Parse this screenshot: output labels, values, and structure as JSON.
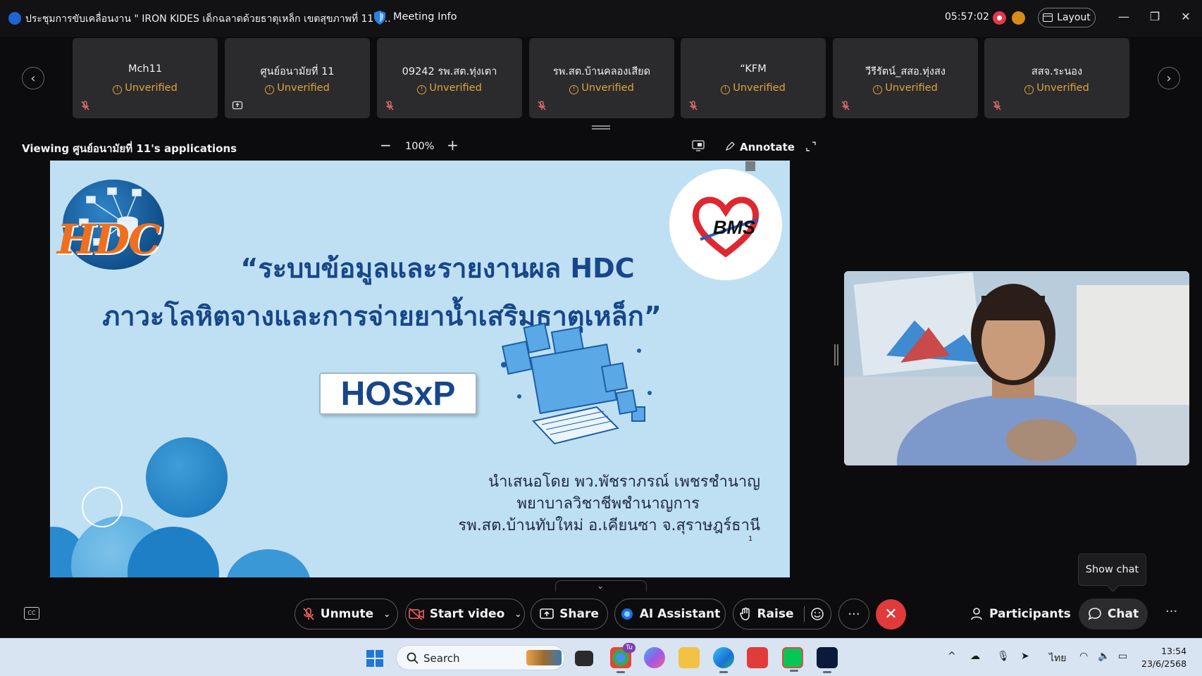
{
  "window": {
    "title": "ประชุมการขับเคลื่อนงาน \" IRON KIDES เด็กฉลาดด้วยธาตุเหล็ก เขตสุขภาพที่ 11\" ...",
    "meeting_info": "Meeting Info",
    "elapsed_time": "05:57:02",
    "layout_label": "Layout"
  },
  "participants": [
    {
      "name": "Mch11",
      "status": "Unverified",
      "icon": "mic-muted-icon"
    },
    {
      "name": "ศูนย์อนามัยที่ 11",
      "status": "Unverified",
      "icon": "screen-share-icon"
    },
    {
      "name": "09242 รพ.สต.ทุ่งเตา",
      "status": "Unverified",
      "icon": "mic-muted-icon"
    },
    {
      "name": "รพ.สต.บ้านคลองเสียด",
      "status": "Unverified",
      "icon": "mic-muted-icon"
    },
    {
      "name": "“KFM",
      "status": "Unverified",
      "icon": "mic-muted-icon"
    },
    {
      "name": "วีรีรัตน์_สสอ.ทุ่งสง",
      "status": "Unverified",
      "icon": "mic-muted-icon"
    },
    {
      "name": "สสจ.ระนอง",
      "status": "Unverified",
      "icon": "mic-muted-icon"
    }
  ],
  "view_bar": {
    "viewing_label": "Viewing ศูนย์อนามัยที่ 11's applications",
    "zoom_minus": "−",
    "zoom_level": "100%",
    "zoom_plus": "+",
    "annotate_label": "Annotate"
  },
  "slide": {
    "hdc_logo_text": "HDC",
    "bms_logo_text": "BMS",
    "title_line1": "“ระบบข้อมูลและรายงานผล HDC",
    "title_line2": "ภาวะโลหิตจางและการจ่ายยาน้ำเสริมธาตุเหล็ก”",
    "hosxp_label": "HOSxP",
    "presenter_line1": "นำเสนอโดย  พว.พัชราภรณ์  เพชรชำนาญ",
    "presenter_line2": "พยาบาลวิชาชีพชำนาญการ",
    "presenter_line3": "รพ.สต.บ้านทับใหม่ อ.เคียนซา จ.สุราษฎร์ธานี",
    "page_number": "1"
  },
  "toolbar": {
    "unmute": "Unmute",
    "start_video": "Start video",
    "share": "Share",
    "ai_assistant": "AI Assistant",
    "raise": "Raise",
    "more": "···",
    "end": "✕",
    "participants": "Participants",
    "chat": "Chat",
    "overflow": "···",
    "tooltip": "Show chat"
  },
  "taskbar": {
    "search_placeholder": "Search",
    "chrome_badge": "Tu",
    "lang": "ไทย",
    "time": "13:54",
    "date": "23/6/2568"
  },
  "colors": {
    "unverified": "#e0a43a",
    "end_call": "#e03a3a",
    "slide_bg": "#bfe0f2",
    "slide_title": "#17468a"
  }
}
